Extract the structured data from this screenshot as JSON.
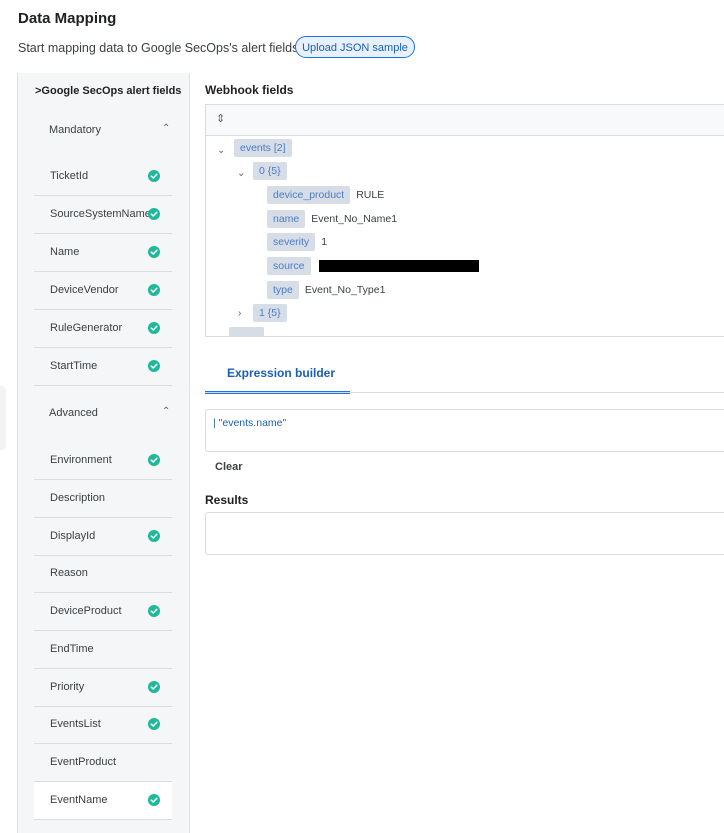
{
  "header": {
    "title": "Data Mapping",
    "subtitle": "Start mapping data to Google SecOps's alert fields.",
    "upload_button": "Upload JSON sample"
  },
  "sidebar": {
    "title": ">Google SecOps alert fields",
    "groups": [
      {
        "label": "Mandatory",
        "fields": [
          {
            "label": "TicketId",
            "mapped": true
          },
          {
            "label": "SourceSystemName",
            "mapped": true
          },
          {
            "label": "Name",
            "mapped": true
          },
          {
            "label": "DeviceVendor",
            "mapped": true
          },
          {
            "label": "RuleGenerator",
            "mapped": true
          },
          {
            "label": "StartTime",
            "mapped": true
          }
        ]
      },
      {
        "label": "Advanced",
        "fields": [
          {
            "label": "Environment",
            "mapped": true
          },
          {
            "label": "Description",
            "mapped": false
          },
          {
            "label": "DisplayId",
            "mapped": true
          },
          {
            "label": "Reason",
            "mapped": false
          },
          {
            "label": "DeviceProduct",
            "mapped": true
          },
          {
            "label": "EndTime",
            "mapped": false
          },
          {
            "label": "Priority",
            "mapped": true
          },
          {
            "label": "EventsList",
            "mapped": true
          },
          {
            "label": "EventProduct",
            "mapped": false
          },
          {
            "label": "EventName",
            "mapped": true,
            "selected": true
          }
        ]
      }
    ]
  },
  "webhook": {
    "label": "Webhook fields",
    "tree": {
      "root": "events [2]",
      "item0": "0 {5}",
      "item1": "1 {5}",
      "fields": [
        {
          "key": "device_product",
          "value": "RULE"
        },
        {
          "key": "name",
          "value": "Event_No_Name1"
        },
        {
          "key": "severity",
          "value": "1"
        },
        {
          "key": "source",
          "value": "",
          "redacted": true
        },
        {
          "key": "type",
          "value": "Event_No_Type1"
        }
      ]
    }
  },
  "expression": {
    "tab_label": "Expression builder",
    "value": "| \"events.name\"",
    "clear_label": "Clear"
  },
  "results": {
    "label": "Results",
    "value": ""
  },
  "colors": {
    "accent": "#1a73e8",
    "check": "#1fb89a"
  }
}
